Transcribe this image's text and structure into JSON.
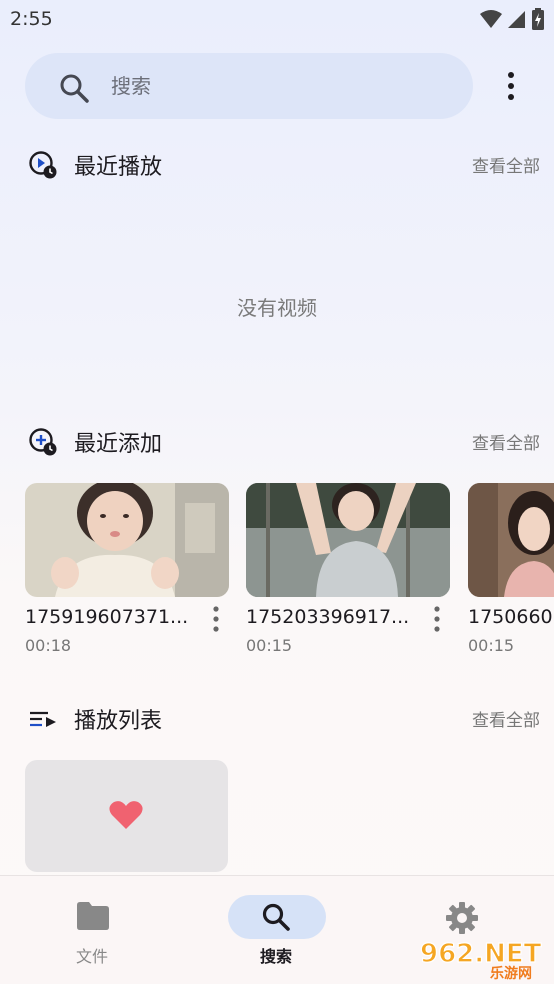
{
  "status_bar": {
    "time": "2:55"
  },
  "search": {
    "placeholder": "搜索"
  },
  "recent_played": {
    "title": "最近播放",
    "view_all": "查看全部",
    "empty_text": "没有视频"
  },
  "recent_added": {
    "title": "最近添加",
    "view_all": "查看全部",
    "videos": [
      {
        "title": "175919607371...",
        "duration": "00:18"
      },
      {
        "title": "175203396917...",
        "duration": "00:15"
      },
      {
        "title": "1750660",
        "duration": "00:15"
      }
    ]
  },
  "playlists": {
    "title": "播放列表",
    "view_all": "查看全部"
  },
  "bottom_nav": {
    "items": [
      {
        "label": "文件",
        "icon": "folder-icon"
      },
      {
        "label": "搜索",
        "icon": "search-icon",
        "active": true
      },
      {
        "label": "",
        "icon": "gear-icon"
      }
    ]
  },
  "watermark": {
    "text": "962.NET",
    "subtext": "乐游网"
  },
  "colors": {
    "accent": "#1f4fc7",
    "heart": "#f06270",
    "search_bg": "#dde5f8"
  }
}
